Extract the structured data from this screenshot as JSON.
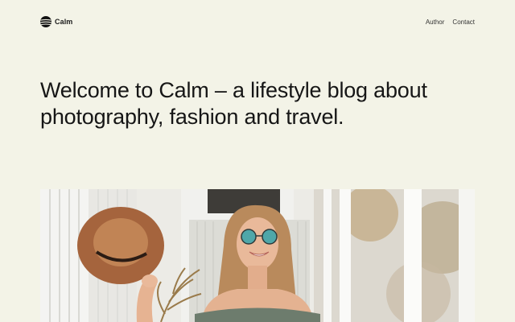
{
  "brand": {
    "name": "Calm",
    "logo_icon": "sun-stripes-logo"
  },
  "nav": {
    "items": [
      {
        "label": "Author"
      },
      {
        "label": "Contact"
      }
    ]
  },
  "hero": {
    "headline": "Welcome to Calm – a lifestyle blog about photography, fashion and travel."
  },
  "colors": {
    "background": "#f3f3e7",
    "text": "#161616"
  }
}
